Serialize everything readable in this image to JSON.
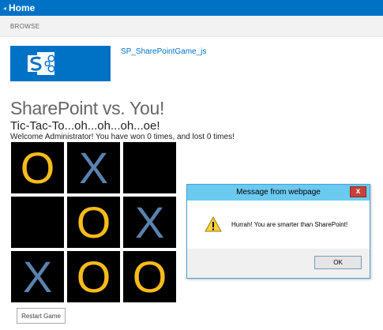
{
  "suite_bar": {
    "back_glyph": "◂",
    "home_label": "Home"
  },
  "ribbon": {
    "browse_label": "BROWSE"
  },
  "site": {
    "logo_icon": "sharepoint-logo",
    "name": "SP_SharePointGame_js"
  },
  "page": {
    "title": "SharePoint vs. You!",
    "subtitle": "Tic-Tac-To...oh...oh...oh...oe!",
    "welcome": "Welcome Administrator! You have won 0 times, and lost 0 times!"
  },
  "board": {
    "cells": [
      "O",
      "X",
      "",
      "",
      "O",
      "X",
      "X",
      "O",
      "O"
    ],
    "o_color": "#f9bb1a",
    "x_color": "#5a82ad"
  },
  "restart_label": "Restart Game",
  "dialog": {
    "title": "Message from webpage",
    "close_glyph": "x",
    "icon": "warning-icon",
    "message": "Hurrah! You are smarter than SharePoint!",
    "ok_label": "OK"
  }
}
